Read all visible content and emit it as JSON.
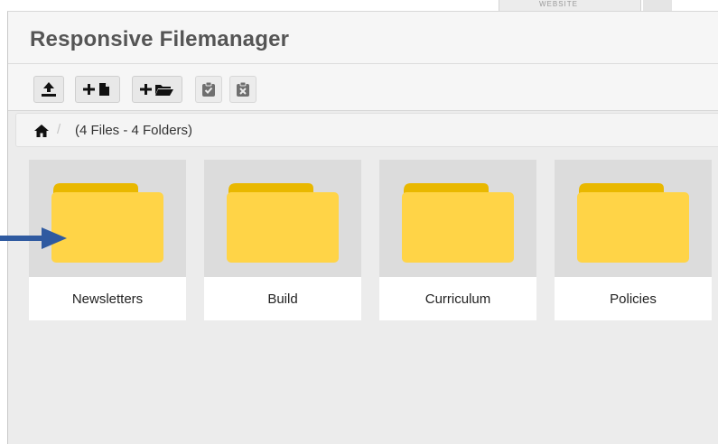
{
  "tab_fragment": "WEBSITE",
  "window": {
    "title": "Responsive Filemanager"
  },
  "toolbar": {
    "buttons": [
      {
        "name": "upload",
        "icon": "upload-icon"
      },
      {
        "name": "new-file",
        "icon": "new-file-icon"
      },
      {
        "name": "new-folder",
        "icon": "new-folder-icon"
      },
      {
        "name": "paste",
        "icon": "clipboard-check-icon",
        "disabled": true
      },
      {
        "name": "clear-clipboard",
        "icon": "clipboard-x-icon",
        "disabled": true
      }
    ]
  },
  "breadcrumb": {
    "separator": "/",
    "summary": "(4 Files - 4 Folders)"
  },
  "folders": [
    {
      "name": "Newsletters"
    },
    {
      "name": "Build"
    },
    {
      "name": "Curriculum"
    },
    {
      "name": "Policies"
    }
  ],
  "colors": {
    "folder_back": "#E9B800",
    "folder_front": "#FFD447",
    "arrow": "#2F5AA0",
    "title": "#555555"
  },
  "annotation": {
    "icon": "arrow-right-icon"
  }
}
